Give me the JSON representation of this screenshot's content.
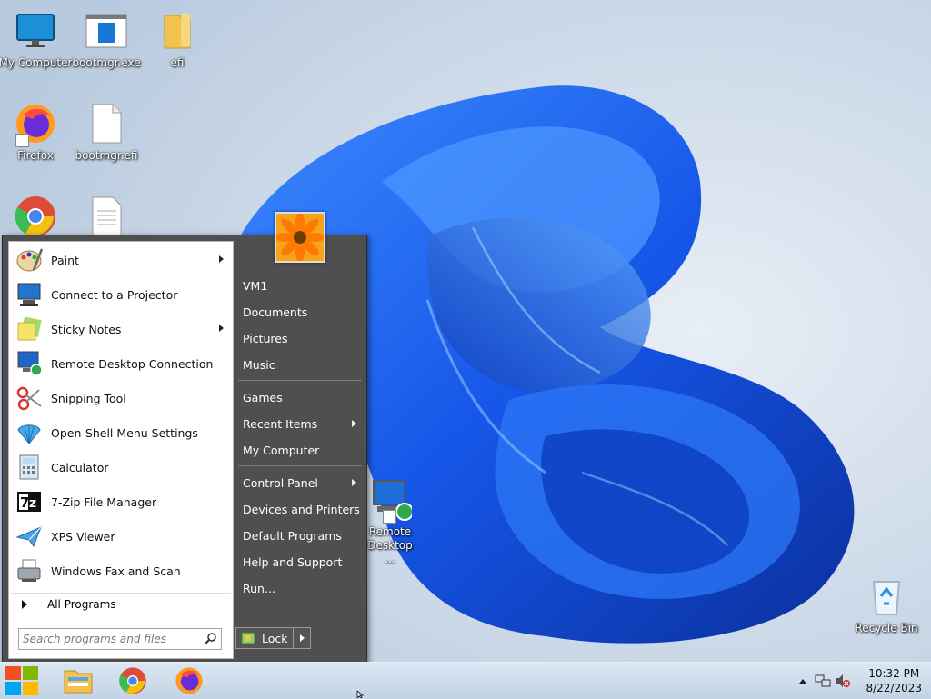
{
  "desktop": {
    "icons": [
      {
        "name": "My Computer"
      },
      {
        "name": "bootmgr.exe"
      },
      {
        "name": "efi"
      },
      {
        "name": "Firefox"
      },
      {
        "name": "bootmgr.efi"
      },
      {
        "name": "Remote Desktop ..."
      },
      {
        "name": "Recycle Bin"
      }
    ]
  },
  "start_menu": {
    "programs": [
      {
        "label": "Paint",
        "icon": "paint-icon",
        "submenu": true
      },
      {
        "label": "Connect to a Projector",
        "icon": "projector-icon",
        "submenu": false
      },
      {
        "label": "Sticky Notes",
        "icon": "sticky-notes-icon",
        "submenu": true
      },
      {
        "label": "Remote Desktop Connection",
        "icon": "remote-desktop-icon",
        "submenu": false
      },
      {
        "label": "Snipping Tool",
        "icon": "scissors-icon",
        "submenu": false
      },
      {
        "label": "Open-Shell Menu Settings",
        "icon": "shell-icon",
        "submenu": false
      },
      {
        "label": "Calculator",
        "icon": "calculator-icon",
        "submenu": false
      },
      {
        "label": "7-Zip File Manager",
        "icon": "7zip-icon",
        "submenu": false
      },
      {
        "label": "XPS Viewer",
        "icon": "xps-icon",
        "submenu": false
      },
      {
        "label": "Windows Fax and Scan",
        "icon": "fax-icon",
        "submenu": false
      }
    ],
    "all_programs": "All Programs",
    "search_placeholder": "Search programs and files",
    "right": [
      {
        "label": "VM1",
        "submenu": false
      },
      {
        "label": "Documents",
        "submenu": false
      },
      {
        "label": "Pictures",
        "submenu": false
      },
      {
        "label": "Music",
        "submenu": false
      },
      {
        "label": "Games",
        "submenu": false
      },
      {
        "label": "Recent Items",
        "submenu": true
      },
      {
        "label": "My Computer",
        "submenu": false
      },
      {
        "label": "Control Panel",
        "submenu": true
      },
      {
        "label": "Devices and Printers",
        "submenu": false
      },
      {
        "label": "Default Programs",
        "submenu": false
      },
      {
        "label": "Help and Support",
        "submenu": false
      },
      {
        "label": "Run...",
        "submenu": false
      }
    ],
    "lock_label": "Lock"
  },
  "taskbar": {
    "apps": [
      "file-explorer-icon",
      "chrome-icon",
      "firefox-icon"
    ],
    "time": "10:32 PM",
    "date": "8/22/2023"
  },
  "colors": {
    "wallpaper_bg": "#c9d7e6",
    "bloom_blue": "#1a5fe0",
    "menu_dark": "#4f4f4f"
  }
}
